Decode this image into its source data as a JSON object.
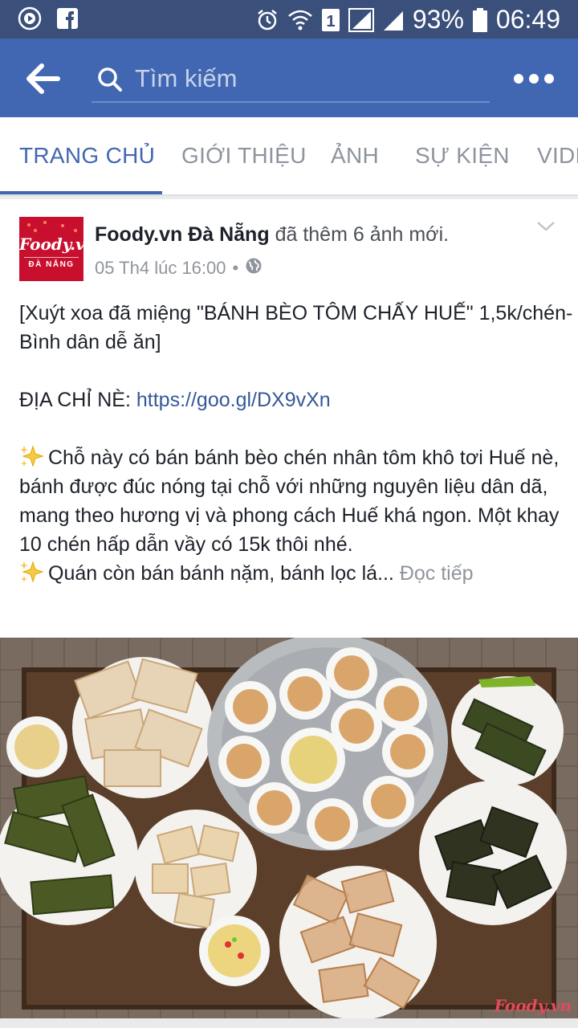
{
  "status_bar": {
    "battery": "93%",
    "time": "06:49",
    "icons": [
      "media-play-icon",
      "facebook-icon",
      "alarm-icon",
      "wifi-icon",
      "sim-1-icon",
      "signal-icon",
      "signal-icon-2",
      "battery-icon"
    ]
  },
  "app_bar": {
    "search_placeholder": "Tìm kiếm",
    "icons": [
      "back-arrow-icon",
      "search-icon",
      "more-icon"
    ]
  },
  "tabs": [
    {
      "label": "TRANG CHỦ",
      "active": true
    },
    {
      "label": "GIỚI THIỆU",
      "active": false
    },
    {
      "label": "ẢNH",
      "active": false
    },
    {
      "label": "SỰ KIỆN",
      "active": false
    },
    {
      "label": "VIDE",
      "active": false
    }
  ],
  "post": {
    "avatar_text": "Foody.vn",
    "avatar_sub": "ĐÀ NẴNG",
    "page_name": "Foody.vn Đà Nẵng",
    "action": "đã thêm 6 ảnh mới.",
    "timestamp": "05 Th4 lúc 16:00",
    "meta_separator": "•",
    "line1": "[Xuýt xoa đã miệng \"BÁNH BÈO TÔM CHẤY HUẾ\" 1,5k/chén- Bình dân dễ ăn]",
    "address_label": "ĐỊA CHỈ NÈ:",
    "address_link": "https://goo.gl/DX9vXn",
    "para1": "Chỗ này có bán bánh bèo chén nhân tôm khô tơi Huế nè, bánh được đúc nóng tại chỗ với những nguyên liệu dân dã, mang theo hương vị và phong cách Huế khá ngon. Một khay 10 chén hấp dẫn vầy có 15k thôi nhé.",
    "para2": "Quán còn bán bánh nặm, bánh lọc lá...",
    "see_more": "Đọc tiếp",
    "photo_watermark": "Foody.vn",
    "accent_color": "#4267b2"
  }
}
